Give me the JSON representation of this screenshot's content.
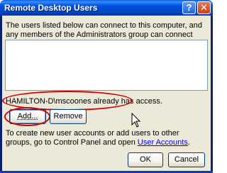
{
  "window": {
    "title": "Remote Desktop Users",
    "help_glyph": "?",
    "close_glyph": "✕"
  },
  "dialog": {
    "description": "The users listed below can connect to this computer, and any members of the Administrators group can connect even if they are not listed.",
    "users": [],
    "access_status": "HAMILTON-D\\mscoones already has access.",
    "add_label": "Add...",
    "remove_label": "Remove",
    "info_prefix": "To create new user accounts or add users to other groups, go to Control Panel and open ",
    "info_link": "User Accounts",
    "info_suffix": ".",
    "ok_label": "OK",
    "cancel_label": "Cancel"
  },
  "colors": {
    "titlebar": "#0054e3",
    "dialog_bg": "#ece9d8",
    "highlight_ellipse": "#d40000",
    "link": "#0000ff"
  },
  "icons": {
    "help": "help-icon",
    "close": "close-icon",
    "cursor": "mouse-pointer-icon"
  }
}
